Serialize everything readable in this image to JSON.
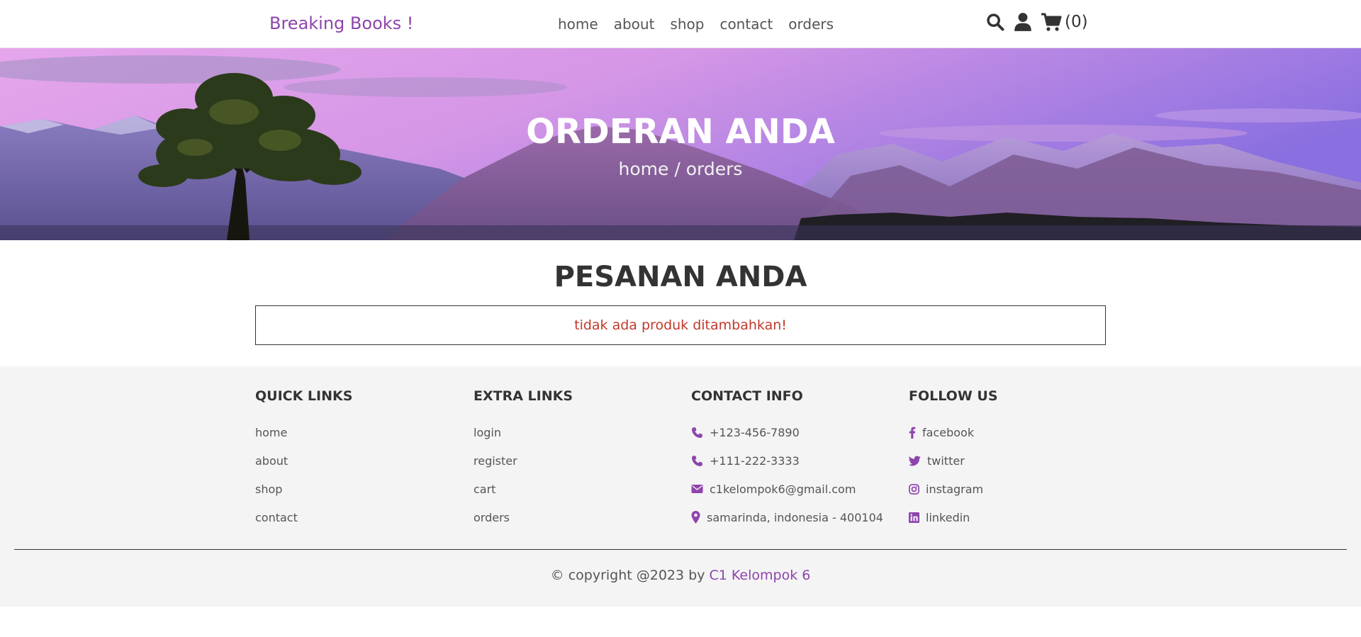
{
  "header": {
    "logo": "Breaking Books !",
    "nav": [
      {
        "label": "home"
      },
      {
        "label": "about"
      },
      {
        "label": "shop"
      },
      {
        "label": "contact"
      },
      {
        "label": "orders"
      }
    ],
    "icons": [
      "search-icon",
      "user-icon",
      "cart-icon"
    ],
    "cart_count": "(0)"
  },
  "hero": {
    "title": "ORDERAN ANDA",
    "breadcrumb_home": "home",
    "breadcrumb_sep": " / ",
    "breadcrumb_current": "orders"
  },
  "orders": {
    "title": "PESANAN ANDA",
    "empty_message": "tidak ada produk ditambahkan!"
  },
  "footer": {
    "quick_links": {
      "title": "QUICK LINKS",
      "items": [
        "home",
        "about",
        "shop",
        "contact"
      ]
    },
    "extra_links": {
      "title": "EXTRA LINKS",
      "items": [
        "login",
        "register",
        "cart",
        "orders"
      ]
    },
    "contact_info": {
      "title": "CONTACT INFO",
      "items": [
        {
          "icon": "phone-icon",
          "text": "+123-456-7890"
        },
        {
          "icon": "phone-icon",
          "text": "+111-222-3333"
        },
        {
          "icon": "envelope-icon",
          "text": "c1kelompok6@gmail.com"
        },
        {
          "icon": "map-marker-icon",
          "text": "samarinda, indonesia - 400104"
        }
      ]
    },
    "follow_us": {
      "title": "FOLLOW US",
      "items": [
        {
          "icon": "facebook-icon",
          "text": "facebook"
        },
        {
          "icon": "twitter-icon",
          "text": "twitter"
        },
        {
          "icon": "instagram-icon",
          "text": "instagram"
        },
        {
          "icon": "linkedin-icon",
          "text": "linkedin"
        }
      ]
    },
    "credit_prefix": "© copyright @2023 by ",
    "credit_brand": "C1 Kelompok 6"
  },
  "colors": {
    "accent": "#8e44ad",
    "error": "#c0392b",
    "text": "#333333",
    "footer_bg": "#f4f4f4"
  }
}
